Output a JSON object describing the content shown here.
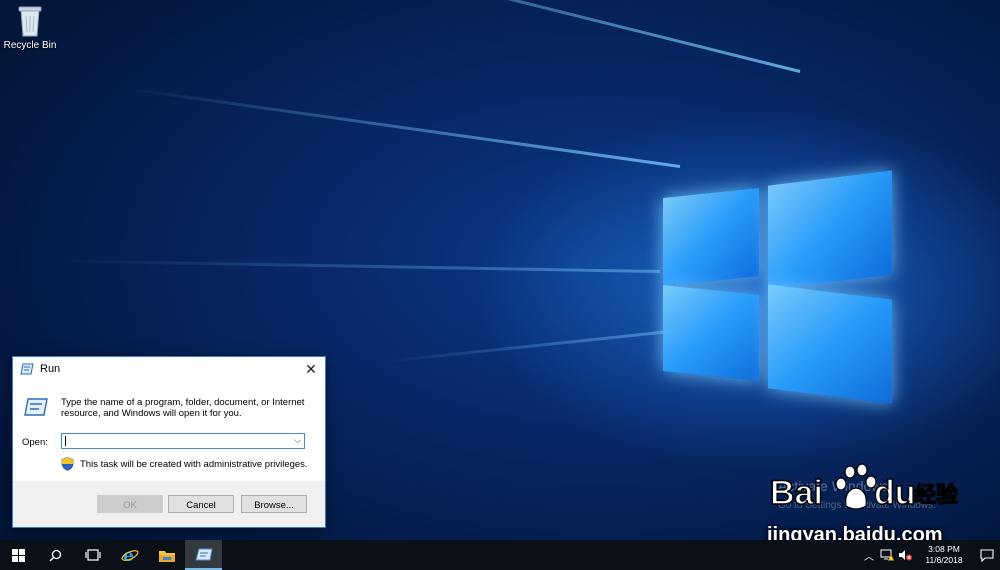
{
  "desktop": {
    "icons": [
      {
        "label": "Recycle Bin",
        "icon": "recycle-bin-icon"
      }
    ],
    "watermark": {
      "activate": "Activate Windows",
      "settings": "Go to Settings to activate Windows.",
      "brand": "Baidu经验",
      "url": "jingyan.baidu.com"
    }
  },
  "run_dialog": {
    "title": "Run",
    "description": "Type the name of a program, folder, document, or Internet resource, and Windows will open it for you.",
    "open_label": "Open:",
    "open_value": "",
    "admin_note": "This task will be created with administrative privileges.",
    "buttons": {
      "ok": "OK",
      "cancel": "Cancel",
      "browse": "Browse..."
    }
  },
  "taskbar": {
    "pinned": [
      "start-icon",
      "search-icon",
      "task-view-icon",
      "internet-explorer-icon",
      "file-explorer-icon",
      "run-icon"
    ],
    "clock": {
      "time": "3:08 PM",
      "date": "11/6/2018"
    }
  },
  "colors": {
    "taskbar": "#0b0f18",
    "accent": "#3c8bd9"
  }
}
